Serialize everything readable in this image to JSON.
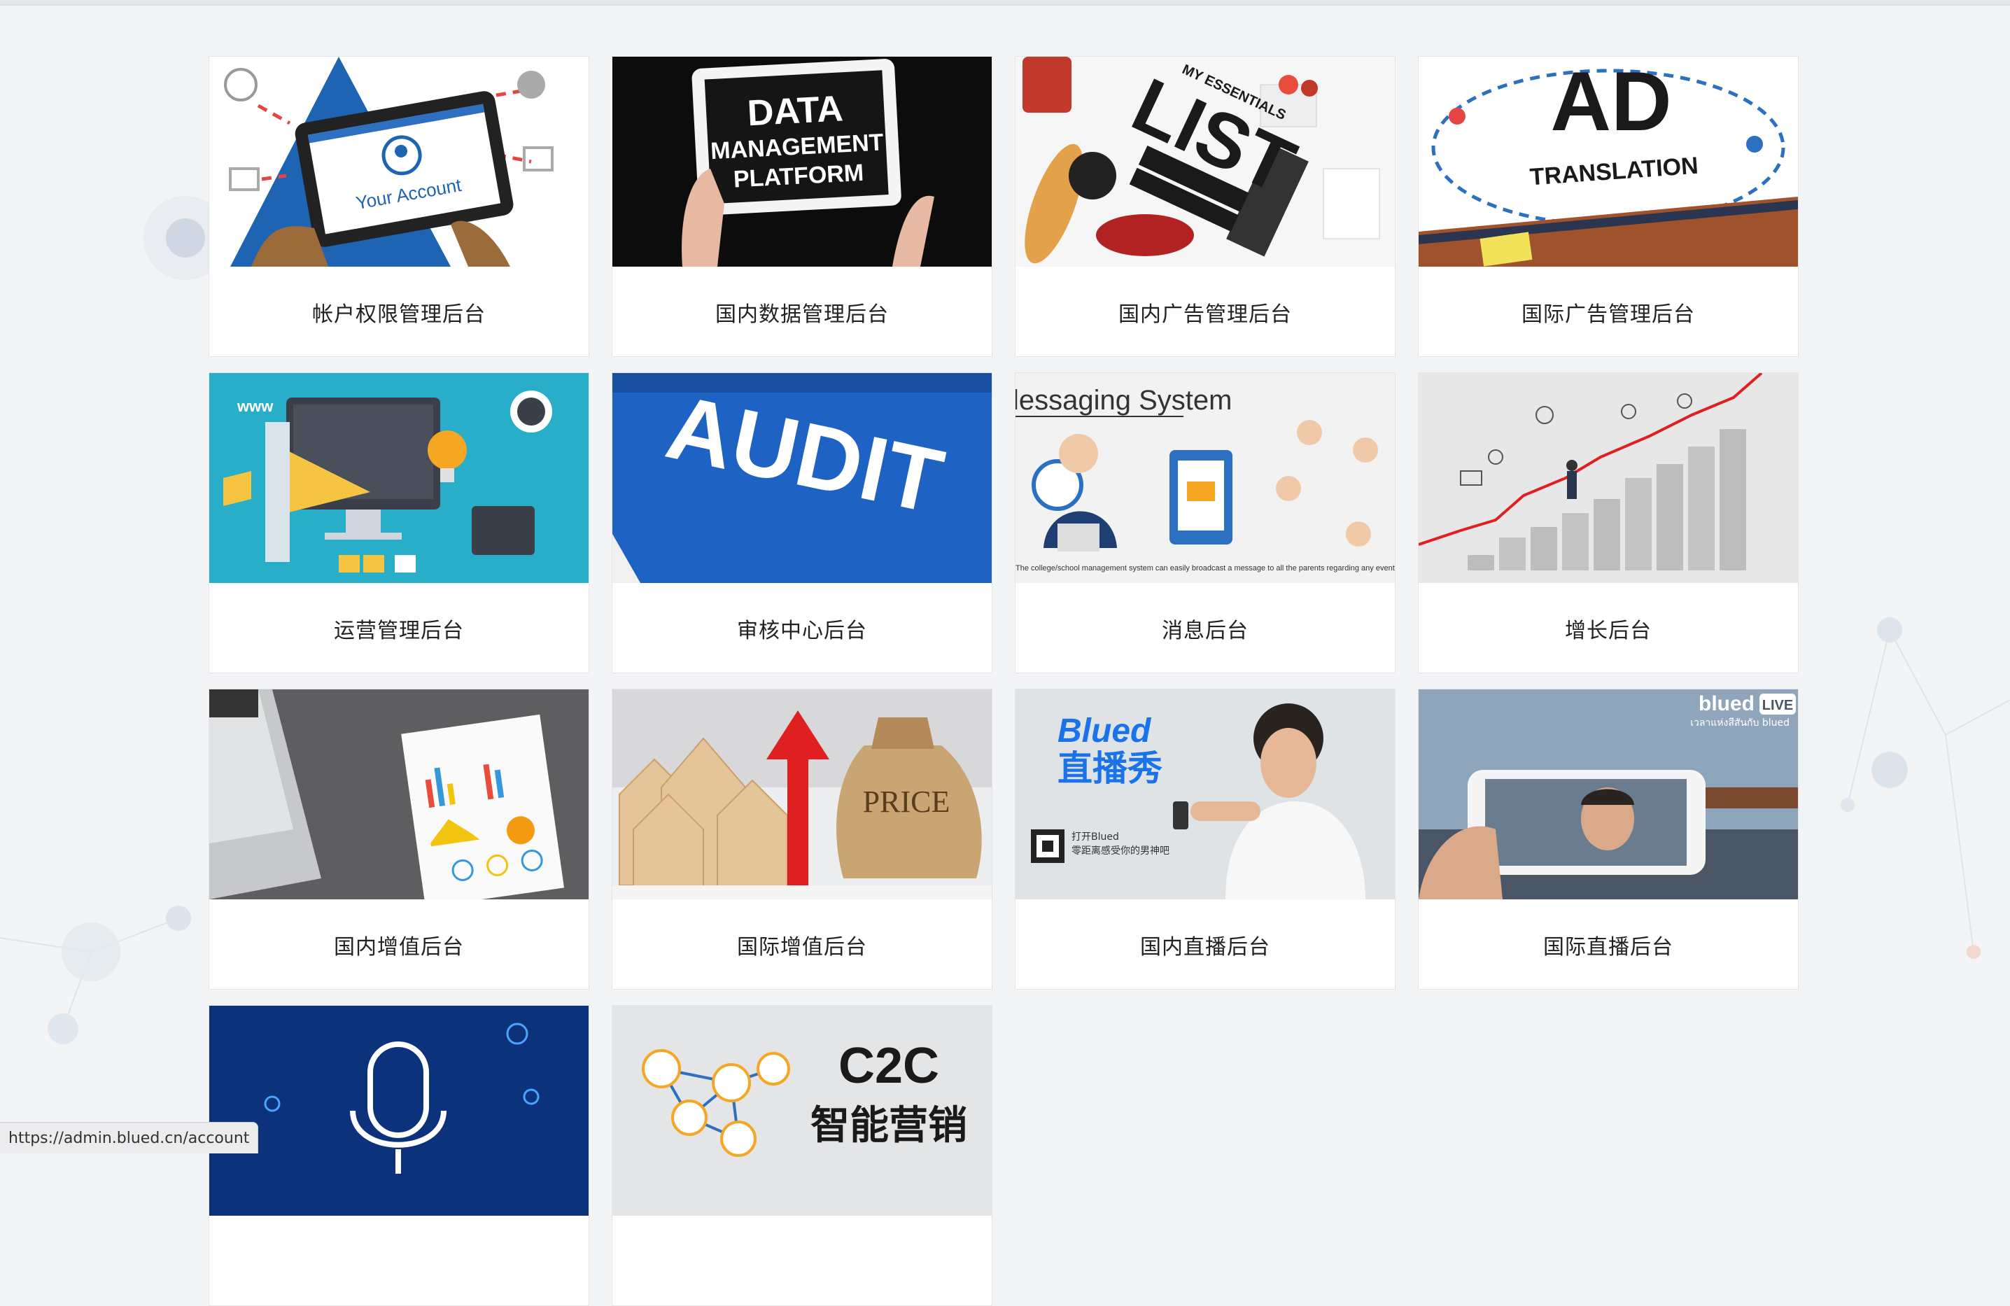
{
  "cards": [
    {
      "title": "帐户权限管理后台",
      "image_text": "Your Account"
    },
    {
      "title": "国内数据管理后台",
      "image_text": "DATA MANAGEMENT PLATFORM"
    },
    {
      "title": "国内广告管理后台",
      "image_text": "LIST"
    },
    {
      "title": "国际广告管理后台",
      "image_text": "AD",
      "image_subtext": "TRANSLATION"
    },
    {
      "title": "运营管理后台",
      "image_text": "www"
    },
    {
      "title": "审核中心后台",
      "image_text": "AUDIT"
    },
    {
      "title": "消息后台",
      "image_text": "lessaging System"
    },
    {
      "title": "增长后台"
    },
    {
      "title": "国内增值后台"
    },
    {
      "title": "国际增值后台",
      "image_text": "PRICE"
    },
    {
      "title": "国内直播后台",
      "image_text": "Blued",
      "image_subtext": "直播秀"
    },
    {
      "title": "国际直播后台",
      "image_text": "blued",
      "image_subtext": "LIVE"
    },
    {
      "title": "",
      "image_text": ""
    },
    {
      "title": "",
      "image_text": "C2C",
      "image_subtext": "智能营销"
    }
  ],
  "statusbar": {
    "url": "https://admin.blued.cn/account"
  },
  "colors": {
    "page_bg": "#f3f4f6",
    "card_bg": "#ffffff",
    "text": "#222222"
  }
}
